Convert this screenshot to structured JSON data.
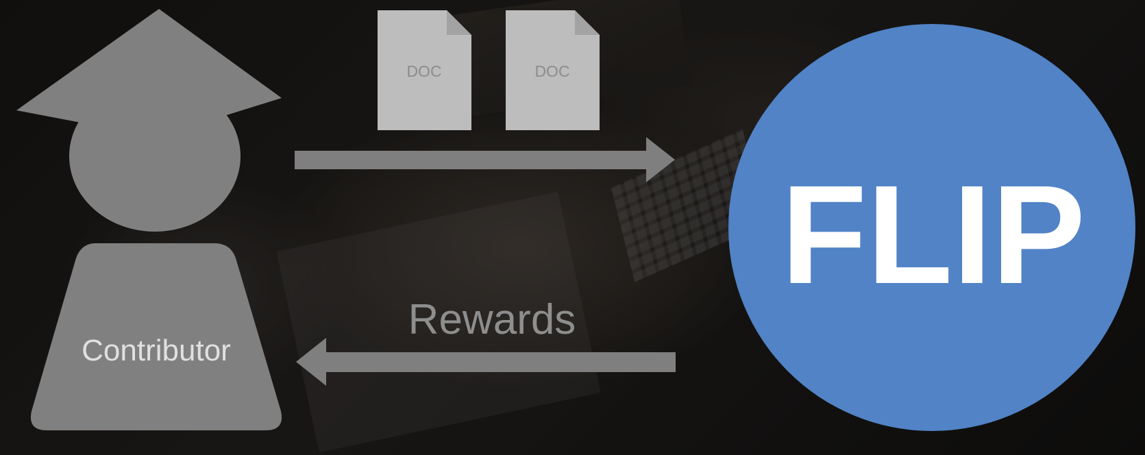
{
  "contributor": {
    "label": "Contributor",
    "icon": "graduate-icon"
  },
  "documents": [
    {
      "label": "DOC",
      "icon": "document-icon"
    },
    {
      "label": "DOC",
      "icon": "document-icon"
    }
  ],
  "flows": {
    "submit_direction": "right",
    "rewards_label": "Rewards",
    "rewards_direction": "left"
  },
  "platform": {
    "label": "FLIP",
    "color": "#5183c6"
  },
  "colors": {
    "figure_gray": "#808080",
    "arrow_gray": "#7f7f7f",
    "doc_gray": "#bdbdbd",
    "text_white": "#ffffff"
  }
}
